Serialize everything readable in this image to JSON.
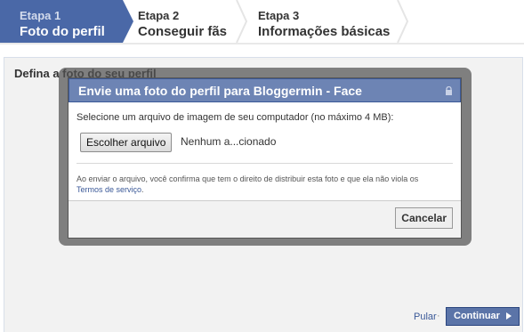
{
  "steps": [
    {
      "num": "Etapa 1",
      "name": "Foto do perfil"
    },
    {
      "num": "Etapa 2",
      "name": "Conseguir fãs"
    },
    {
      "num": "Etapa 3",
      "name": "Informações básicas"
    }
  ],
  "page": {
    "title": "Defina a foto do seu perfil",
    "skip_label": "Pular",
    "separator": "·",
    "continue_label": "Continuar"
  },
  "dialog": {
    "title": "Envie uma foto do perfil para Bloggermin - Face",
    "instructions": "Selecione um arquivo de imagem de seu computador (no máximo 4 MB):",
    "choose_button": "Escolher arquivo",
    "file_status": "Nenhum a...cionado",
    "legal_text": "Ao enviar o arquivo, você confirma que tem o direito de distribuir esta foto e que ela não viola os",
    "terms_link": "Termos de serviço",
    "cancel_button": "Cancelar"
  },
  "colors": {
    "brand_blue": "#3b5998",
    "active_step": "#4a68a7",
    "dialog_header": "#6d84b4"
  },
  "icons": {
    "header_icon": "lock-icon",
    "continue_icon": "triangle-right-icon"
  }
}
